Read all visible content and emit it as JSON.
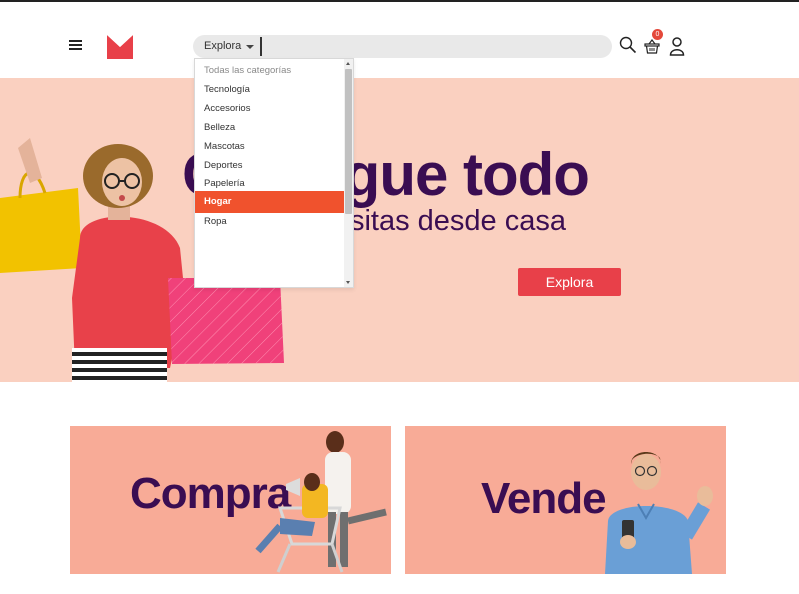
{
  "header": {
    "search": {
      "category_label": "Explora",
      "placeholder": ""
    },
    "cart_count": "0",
    "icons": {
      "menu": "hamburger-icon",
      "search": "search-icon",
      "cart": "basket-icon",
      "user": "user-icon"
    }
  },
  "dropdown": {
    "items": [
      {
        "label": "Todas las categorías"
      },
      {
        "label": "Tecnología"
      },
      {
        "label": "Accesorios"
      },
      {
        "label": "Belleza"
      },
      {
        "label": "Mascotas"
      },
      {
        "label": "Deportes"
      },
      {
        "label": "Papelería"
      },
      {
        "label": "Hogar"
      },
      {
        "label": "Ropa"
      }
    ],
    "selected": "Hogar"
  },
  "hero": {
    "title": "Consigue todo",
    "subtitle": "lo que necesitas desde casa",
    "button_label": "Explora"
  },
  "cards": {
    "left_label": "Compra",
    "right_label": "Vende"
  },
  "colors": {
    "brand": "#e84049",
    "dark_purple": "#3a0d52",
    "hero_bg": "#fad0c0",
    "card_bg": "#f8ab97",
    "dropdown_active": "#f0522d"
  }
}
